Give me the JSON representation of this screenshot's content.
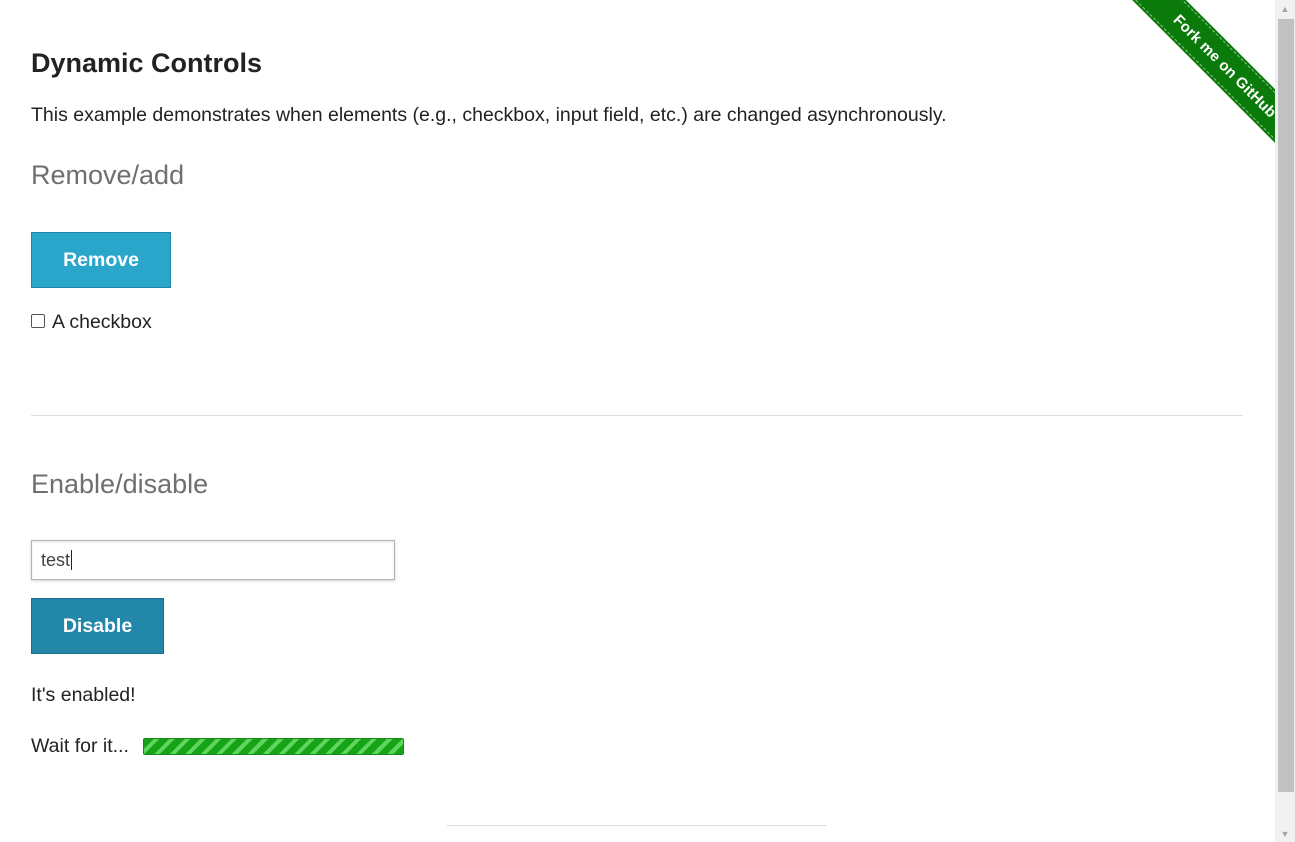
{
  "ribbon": {
    "label": "Fork me on GitHub",
    "color": "#0a7a0a"
  },
  "page": {
    "title": "Dynamic Controls",
    "description": "This example demonstrates when elements (e.g., checkbox, input field, etc.) are changed asynchronously."
  },
  "remove_add": {
    "heading": "Remove/add",
    "button_label": "Remove",
    "checkbox_label": "A checkbox",
    "checkbox_checked": false
  },
  "enable_disable": {
    "heading": "Enable/disable",
    "input_value": "test",
    "button_label": "Disable",
    "status_message": "It's enabled!",
    "loading_label": "Wait for it...",
    "loading_progress_fraction": 1.0
  },
  "colors": {
    "button": "#2ba6cb",
    "button_dark": "#2287a8",
    "heading_gray": "#6f6f6f",
    "progress_green": "#1fae1f"
  },
  "icons": {
    "scroll_up": "scroll-up-arrow-icon",
    "scroll_down": "scroll-down-arrow-icon"
  }
}
